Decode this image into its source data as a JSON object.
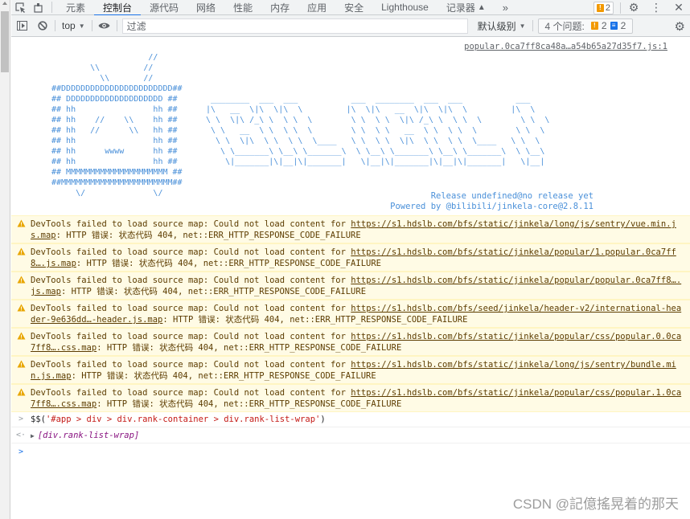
{
  "tabbar": {
    "tabs": [
      {
        "label": "元素",
        "active": false
      },
      {
        "label": "控制台",
        "active": true
      },
      {
        "label": "源代码",
        "active": false
      },
      {
        "label": "网络",
        "active": false
      },
      {
        "label": "性能",
        "active": false
      },
      {
        "label": "内存",
        "active": false
      },
      {
        "label": "应用",
        "active": false
      },
      {
        "label": "安全",
        "active": false
      },
      {
        "label": "Lighthouse",
        "active": false
      },
      {
        "label": "记录器",
        "active": false
      }
    ],
    "more_label": "»",
    "issue_count": "2",
    "icons": {
      "inspect": "inspect-element-icon",
      "device": "device-toggle-icon",
      "settings": "gear-icon",
      "menu": "kebab-menu-icon",
      "close": "close-icon"
    }
  },
  "toolbar": {
    "context": "top",
    "filter_placeholder": "过滤",
    "level": "默认级别",
    "issues_label": "4 个问题:",
    "issues_warn": "2",
    "issues_info": "2"
  },
  "console": {
    "source_link": "popular.0ca7ff8ca48a…a54b65a27d35f7.js:1",
    "ascii_left": "                    //\n        \\\\         //\n          \\\\       //\n##DDDDDDDDDDDDDDDDDDDDDDD##\n## DDDDDDDDDDDDDDDDDDDD ##\n## hh                hh ##\n## hh    //    \\\\    hh ##\n## hh   //      \\\\   hh ##\n## hh                hh ##\n## hh      wwww      hh ##\n## hh                hh ##\n## MMMMMMMMMMMMMMMMMMMMM ##\n##MMMMMMMMMMMMMMMMMMMMMMM##\n     \\/              \\/",
    "ascii_right": " ________  ___  ___           ___  ________  ___  ___           ___\n|\\   __  \\|\\  \\|\\  \\         |\\  \\|\\   __  \\|\\  \\|\\  \\         |\\  \\\n\\ \\  \\|\\ /_\\ \\  \\ \\  \\        \\ \\  \\ \\  \\|\\ /_\\ \\  \\ \\  \\        \\ \\  \\\n \\ \\   __  \\ \\  \\ \\  \\        \\ \\  \\ \\   __  \\ \\  \\ \\  \\        \\ \\  \\\n  \\ \\  \\|\\  \\ \\  \\ \\  \\____   \\ \\  \\ \\  \\|\\  \\ \\  \\ \\  \\____   \\ \\  \\\n   \\ \\_______\\ \\__\\ \\_______\\  \\ \\__\\ \\_______\\ \\__\\ \\_______\\  \\ \\__\\\n    \\|_______|\\|__|\\|_______|   \\|__|\\|_______|\\|__|\\|_______|   \\|__|",
    "release_line": "Release undefined@no release yet",
    "powered_line": "Powered by @bilibili/jinkela-core@2.8.11",
    "warnings": [
      {
        "prefix": "DevTools failed to load source map: Could not load content for ",
        "url": "https://s1.hdslb.com/bfs/static/jinkela/long/js/sentry/vue.min.js.map",
        "suffix": ": HTTP 错误: 状态代码 404, net::ERR_HTTP_RESPONSE_CODE_FAILURE"
      },
      {
        "prefix": "DevTools failed to load source map: Could not load content for ",
        "url": "https://s1.hdslb.com/bfs/static/jinkela/popular/1.popular.0ca7ff8….js.map",
        "suffix": ": HTTP 错误: 状态代码 404, net::ERR_HTTP_RESPONSE_CODE_FAILURE"
      },
      {
        "prefix": "DevTools failed to load source map: Could not load content for ",
        "url": "https://s1.hdslb.com/bfs/static/jinkela/popular/popular.0ca7ff8….js.map",
        "suffix": ": HTTP 错误: 状态代码 404, net::ERR_HTTP_RESPONSE_CODE_FAILURE"
      },
      {
        "prefix": "DevTools failed to load source map: Could not load content for ",
        "url": "https://s1.hdslb.com/bfs/seed/jinkela/header-v2/international-header-9e636dd…-header.js.map",
        "suffix": ": HTTP 错误: 状态代码 404, net::ERR_HTTP_RESPONSE_CODE_FAILURE"
      },
      {
        "prefix": "DevTools failed to load source map: Could not load content for ",
        "url": "https://s1.hdslb.com/bfs/static/jinkela/popular/css/popular.0.0ca7ff8….css.map",
        "suffix": ": HTTP 错误: 状态代码 404, net::ERR_HTTP_RESPONSE_CODE_FAILURE"
      },
      {
        "prefix": "DevTools failed to load source map: Could not load content for ",
        "url": "https://s1.hdslb.com/bfs/static/jinkela/long/js/sentry/bundle.min.js.map",
        "suffix": ": HTTP 错误: 状态代码 404, net::ERR_HTTP_RESPONSE_CODE_FAILURE"
      },
      {
        "prefix": "DevTools failed to load source map: Could not load content for ",
        "url": "https://s1.hdslb.com/bfs/static/jinkela/popular/css/popular.1.0ca7ff8….css.map",
        "suffix": ": HTTP 错误: 状态代码 404, net::ERR_HTTP_RESPONSE_CODE_FAILURE"
      }
    ],
    "command": {
      "fn": "$$(",
      "arg": "'#app > div > div.rank-container > div.rank-list-wrap'",
      "close": ")"
    },
    "result": "[div.rank-list-wrap]"
  },
  "watermark": "CSDN @記億搖晃着的那天"
}
